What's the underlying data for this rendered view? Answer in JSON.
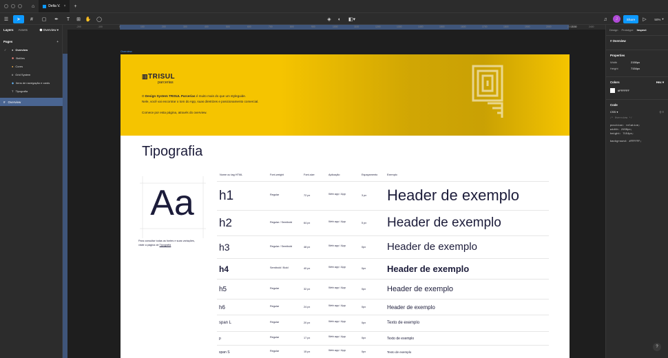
{
  "titlebar": {
    "tab_label": "Delta V.",
    "add_tab": "+"
  },
  "toolbar": {
    "share_label": "Share",
    "zoom": "50%",
    "avatar_initial": "J"
  },
  "left": {
    "tabs": [
      "Layers",
      "Assets"
    ],
    "page_dropdown": "Overview",
    "pages_title": "Pages",
    "add_page": "+",
    "pages": [
      {
        "icon": "●",
        "label": "Overview",
        "current": true
      },
      {
        "icon": "✱",
        "label": "Botões"
      },
      {
        "icon": "●",
        "label": "Cores"
      },
      {
        "icon": "#",
        "label": "Grid System"
      },
      {
        "icon": "◆",
        "label": "Itens de navegação e cards"
      },
      {
        "icon": "T",
        "label": "Tipografia"
      }
    ],
    "selected_layer": "Overview"
  },
  "right": {
    "tabs": [
      "Design",
      "Prototype",
      "Inspect"
    ],
    "frame_name": "Overview",
    "properties_title": "Properties",
    "width_label": "Width",
    "width_value": "2150px",
    "height_label": "Height",
    "height_value": "7154px",
    "colors_title": "Colors",
    "colors_format": "Hex",
    "color_value": "#FFFFFF",
    "code_title": "Code",
    "code_lang": "CSS",
    "code_lines": [
      "/* Overview */",
      "position: relative;",
      "width: 2150px;",
      "height: 7154px;",
      "background: #FFFFFF;"
    ]
  },
  "canvas": {
    "frame_label": "Overview",
    "ruler_left_value": "-200",
    "ruler_right_value": "2150",
    "ruler_ticks": [
      "-200",
      "-100",
      "0",
      "100",
      "200",
      "300",
      "400",
      "500",
      "600",
      "700",
      "800",
      "900",
      "1000",
      "1100",
      "1200",
      "1300",
      "1400",
      "1500",
      "1600",
      "1700",
      "1800",
      "1900",
      "2000",
      "2300",
      "2400"
    ]
  },
  "hero": {
    "logo": "TRISUL",
    "logo_sub": "parcerias",
    "line1_prefix": "O ",
    "line1_bold": "Design System TRISUL Parcerias",
    "line1_suffix": " é muito mais do que um styleguide.",
    "line2": "Nele, você vai encontrar o tom do App, suas diretrizes e posicionamento comercial.",
    "line3": "Comece por esta página, através do overview."
  },
  "tipografia": {
    "title": "Tipografia",
    "aa": "Aa",
    "note1": "Para consultar todas as fontes e suas variações,",
    "note2_prefix": "visite a página de ",
    "note2_link": "Tipografia",
    "headers": [
      "Nome ou tag HTML",
      "Font-weight",
      "Font-size",
      "Aplicação",
      "Espaçamento",
      "Exemplo"
    ],
    "rows": [
      {
        "tag": "h1",
        "weight": "Regular",
        "size": "72 px",
        "app": "Web app / App",
        "spacing": "3 px",
        "example": "Header de exemplo"
      },
      {
        "tag": "h2",
        "weight": "Regular / Semibold",
        "size": "64 px",
        "app": "Web app / App",
        "spacing": "5 px",
        "example": "Header de exemplo"
      },
      {
        "tag": "h3",
        "weight": "Regular / Semibold",
        "size": "48 px",
        "app": "Web app / App",
        "spacing": "0px",
        "example": "Header de exemplo"
      },
      {
        "tag": "h4",
        "weight": "Semibold / Bold",
        "size": "40 px",
        "app": "Web app / App",
        "spacing": "0px",
        "example": "Header de exemplo"
      },
      {
        "tag": "h5",
        "weight": "Regular",
        "size": "32 px",
        "app": "Web app / App",
        "spacing": "0px",
        "example": "Header de exemplo"
      },
      {
        "tag": "h6",
        "weight": "Regular",
        "size": "24 px",
        "app": "Web app / App",
        "spacing": "0px",
        "example": "Header de exemplo"
      },
      {
        "tag": "span L",
        "weight": "Regular",
        "size": "20 px",
        "app": "Web app / App",
        "spacing": "0px",
        "example": "Texto de exemplo"
      },
      {
        "tag": "p",
        "weight": "Regular",
        "size": "17 px",
        "app": "Web app / App",
        "spacing": "0px",
        "example": "Texto de exemplo"
      },
      {
        "tag": "span S",
        "weight": "Regular",
        "size": "15 px",
        "app": "Web app / App",
        "spacing": "0px",
        "example": "Texto de exemplo"
      }
    ]
  },
  "help": "?",
  "colors": {
    "accent": "#0d99ff",
    "brand_yellow": "#f5c400",
    "text_dark": "#1c1c3a",
    "panel": "#2c2c2c",
    "selection": "#4a6591"
  }
}
